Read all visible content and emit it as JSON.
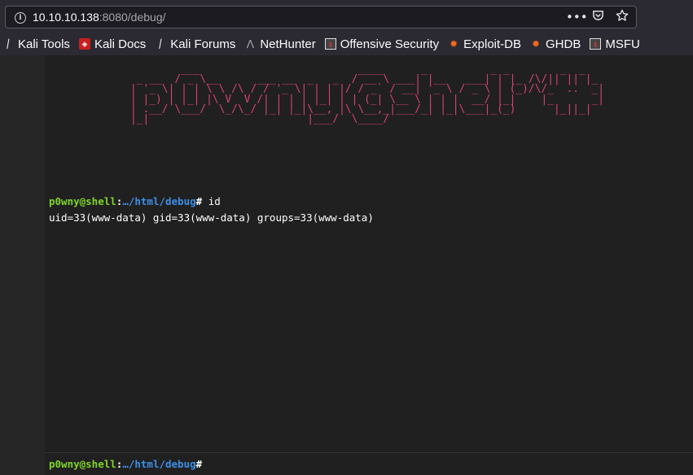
{
  "browser": {
    "url_host": "10.10.10.138",
    "url_rest": ":8080/debug/",
    "icons": [
      "info-icon",
      "more-icon",
      "pocket-icon",
      "star-icon"
    ]
  },
  "bookmarks": [
    {
      "label": "Kali Tools",
      "icon": "kali-dragon-icon"
    },
    {
      "label": "Kali Docs",
      "icon": "kali-docs-icon"
    },
    {
      "label": "Kali Forums",
      "icon": "kali-dragon-icon"
    },
    {
      "label": "NetHunter",
      "icon": "nethunter-icon"
    },
    {
      "label": "Offensive Security",
      "icon": "offsec-icon"
    },
    {
      "label": "Exploit-DB",
      "icon": "exploit-db-icon"
    },
    {
      "label": "GHDB",
      "icon": "exploit-db-icon"
    },
    {
      "label": "MSFU",
      "icon": "offsec-icon"
    }
  ],
  "terminal": {
    "banner": "        ___                         ____      _          _ _        _  _   \n _ __  / _ \\__      ___ __  _   _  / __ \\ ___| |__   ___| | |_ /\\/|| || |_ \n| '_ \\| | | \\ \\ /\\ / / '_ \\| | | |/ / _` / __| '_ \\ / _ \\ | (_)/\\/_  ..  _|\n| |_) | |_| |\\ V  V /| | | | |_| | | (_| \\__ \\ | | |  __/ |_|    |_      _|\n| .__/ \\___/  \\_/\\_/ |_| |_|\\__, |\\ \\__,_|___/_| |_|\\___|_(_)      |_||_|  \n|_|                         |___/  \\____/                                  ",
    "prompt_user": "p0wny@shell",
    "prompt_sep": ":",
    "prompt_path": "…/html/debug",
    "prompt_hash": "#",
    "command": " id",
    "output": "uid=33(www-data) gid=33(www-data) groups=33(www-data)"
  },
  "colors": {
    "banner": "#d6436e",
    "user": "#7fd62a",
    "path": "#3d8fe6",
    "background": "#202020"
  }
}
